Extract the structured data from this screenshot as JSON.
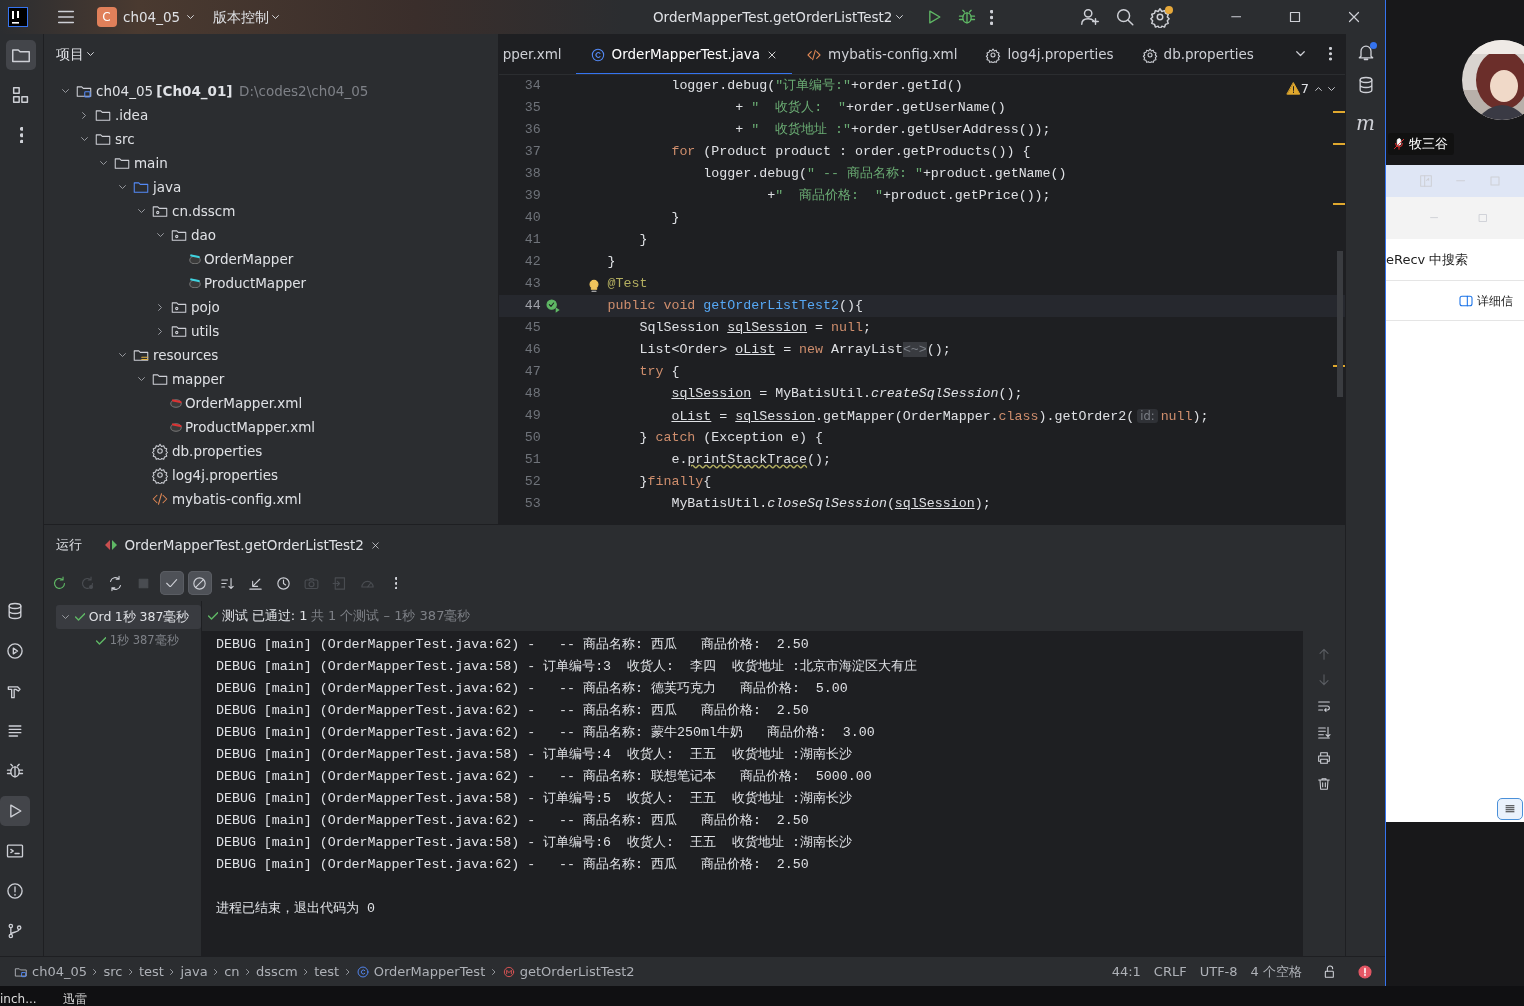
{
  "title_bar": {
    "project_initial": "C",
    "project": "ch04_05",
    "vcs": "版本控制",
    "run_config": "OrderMapperTest.getOrderListTest2"
  },
  "left_strip": {
    "top": [
      {
        "selected": true
      },
      {
        "selected": false
      },
      {
        "selected": false
      }
    ],
    "bottom": [
      {
        "selected": false
      },
      {
        "selected": false
      },
      {
        "selected": false
      },
      {
        "selected": false
      },
      {
        "selected": false
      },
      {
        "selected": true
      },
      {
        "selected": false
      },
      {
        "selected": false
      },
      {
        "selected": false
      }
    ]
  },
  "right_strip": {
    "maven_label": "m"
  },
  "project_panel": {
    "title": "项目",
    "tree": [
      {
        "name": "ch04_05",
        "module": "[Ch04_01]",
        "path": "D:\\codes2\\ch04_05",
        "kind": "module",
        "expanded": true,
        "children": [
          {
            "name": ".idea",
            "kind": "folder",
            "expanded": false
          },
          {
            "name": "src",
            "kind": "folder",
            "expanded": true,
            "children": [
              {
                "name": "main",
                "kind": "folder",
                "expanded": true,
                "children": [
                  {
                    "name": "java",
                    "kind": "source",
                    "expanded": true,
                    "children": [
                      {
                        "name": "cn.dsscm",
                        "kind": "package",
                        "expanded": true,
                        "children": [
                          {
                            "name": "dao",
                            "kind": "package",
                            "expanded": true,
                            "children": [
                              {
                                "name": "OrderMapper",
                                "kind": "mapper"
                              },
                              {
                                "name": "ProductMapper",
                                "kind": "mapper"
                              }
                            ]
                          },
                          {
                            "name": "pojo",
                            "kind": "package",
                            "expanded": false
                          },
                          {
                            "name": "utils",
                            "kind": "package",
                            "expanded": false
                          }
                        ]
                      }
                    ]
                  },
                  {
                    "name": "resources",
                    "kind": "resources",
                    "expanded": true,
                    "children": [
                      {
                        "name": "mapper",
                        "kind": "folder",
                        "expanded": true,
                        "children": [
                          {
                            "name": "OrderMapper.xml",
                            "kind": "mapping"
                          },
                          {
                            "name": "ProductMapper.xml",
                            "kind": "mapping"
                          }
                        ]
                      },
                      {
                        "name": "db.properties",
                        "kind": "properties"
                      },
                      {
                        "name": "log4j.properties",
                        "kind": "properties"
                      },
                      {
                        "name": "mybatis-config.xml",
                        "kind": "xml"
                      }
                    ]
                  }
                ]
              }
            ]
          }
        ]
      }
    ]
  },
  "editor": {
    "tabs": [
      {
        "label": "pper.xml",
        "kind": "plain",
        "selected": false
      },
      {
        "label": "OrderMapperTest.java",
        "kind": "class",
        "selected": true
      },
      {
        "label": "mybatis-config.xml",
        "kind": "xml",
        "selected": false
      },
      {
        "label": "log4j.properties",
        "kind": "properties",
        "selected": false
      },
      {
        "label": "db.properties",
        "kind": "properties",
        "selected": false
      }
    ],
    "warnings": "7",
    "lines": [
      {
        "number": "34",
        "kind": "plain",
        "current": false,
        "segments": [
          {
            "text": "            logger.debug(",
            "kind": "plain"
          },
          {
            "text": "\"订单编号:\"",
            "kind": "string"
          },
          {
            "text": "+order.getId()",
            "kind": "plain"
          }
        ]
      },
      {
        "number": "35",
        "kind": "plain",
        "current": false,
        "segments": [
          {
            "text": "                    + ",
            "kind": "plain"
          },
          {
            "text": "\"  收货人:  \"",
            "kind": "string"
          },
          {
            "text": "+order.getUserName()",
            "kind": "plain"
          }
        ]
      },
      {
        "number": "36",
        "kind": "plain",
        "current": false,
        "segments": [
          {
            "text": "                    + ",
            "kind": "plain"
          },
          {
            "text": "\"  收货地址 :\"",
            "kind": "string"
          },
          {
            "text": "+order.getUserAddress());",
            "kind": "plain"
          }
        ]
      },
      {
        "number": "37",
        "kind": "plain",
        "current": false,
        "segments": [
          {
            "text": "            for",
            "kind": "keyword"
          },
          {
            "text": " (Product product : order.getProducts()) {",
            "kind": "plain"
          }
        ]
      },
      {
        "number": "38",
        "kind": "plain",
        "current": false,
        "segments": [
          {
            "text": "                logger.debug(",
            "kind": "plain"
          },
          {
            "text": "\" -- 商品名称: \"",
            "kind": "string"
          },
          {
            "text": "+product.getName()",
            "kind": "plain"
          }
        ]
      },
      {
        "number": "39",
        "kind": "plain",
        "current": false,
        "segments": [
          {
            "text": "                        +",
            "kind": "plain"
          },
          {
            "text": "\"  商品价格:  \"",
            "kind": "string"
          },
          {
            "text": "+product.getPrice());",
            "kind": "plain"
          }
        ]
      },
      {
        "number": "40",
        "kind": "plain",
        "current": false,
        "segments": [
          {
            "text": "            }",
            "kind": "plain"
          }
        ]
      },
      {
        "number": "41",
        "kind": "plain",
        "current": false,
        "segments": [
          {
            "text": "        }",
            "kind": "plain"
          }
        ]
      },
      {
        "number": "42",
        "kind": "plain",
        "current": false,
        "segments": [
          {
            "text": "    }",
            "kind": "plain"
          }
        ]
      },
      {
        "number": "43",
        "kind": "bulb",
        "current": false,
        "segments": [
          {
            "text": "    @Test",
            "kind": "annotation"
          }
        ]
      },
      {
        "number": "44",
        "kind": "run",
        "current": true,
        "segments": [
          {
            "text": "    public void ",
            "kind": "keyword"
          },
          {
            "text": "getOrderListTest2",
            "kind": "method"
          },
          {
            "text": "(){",
            "kind": "plain"
          }
        ]
      },
      {
        "number": "45",
        "kind": "plain",
        "current": false,
        "segments": [
          {
            "text": "        SqlSession ",
            "kind": "plain"
          },
          {
            "text": "sqlSession",
            "kind": "variable"
          },
          {
            "text": " = ",
            "kind": "plain"
          },
          {
            "text": "null",
            "kind": "keyword"
          },
          {
            "text": ";",
            "kind": "plain"
          }
        ]
      },
      {
        "number": "46",
        "kind": "plain",
        "current": false,
        "segments": [
          {
            "text": "        List<Order> ",
            "kind": "plain"
          },
          {
            "text": "oList",
            "kind": "variable"
          },
          {
            "text": " = ",
            "kind": "plain"
          },
          {
            "text": "new",
            "kind": "keyword"
          },
          {
            "text": " ArrayList",
            "kind": "plain"
          },
          {
            "text": "<~>",
            "kind": "fold"
          },
          {
            "text": "();",
            "kind": "plain"
          }
        ]
      },
      {
        "number": "47",
        "kind": "plain",
        "current": false,
        "segments": [
          {
            "text": "        try",
            "kind": "keyword"
          },
          {
            "text": " {",
            "kind": "plain"
          }
        ]
      },
      {
        "number": "48",
        "kind": "plain",
        "current": false,
        "segments": [
          {
            "text": "            sqlSession",
            "kind": "variable"
          },
          {
            "text": " = MyBatisUtil.",
            "kind": "plain"
          },
          {
            "text": "createSqlSession",
            "kind": "static"
          },
          {
            "text": "();",
            "kind": "plain"
          }
        ]
      },
      {
        "number": "49",
        "kind": "plain",
        "current": false,
        "segments": [
          {
            "text": "            oList",
            "kind": "variable"
          },
          {
            "text": " = ",
            "kind": "plain"
          },
          {
            "text": "sqlSession",
            "kind": "variable"
          },
          {
            "text": ".getMapper(OrderMapper.",
            "kind": "plain"
          },
          {
            "text": "class",
            "kind": "keyword"
          },
          {
            "text": ").getOrder2(",
            "kind": "plain"
          },
          {
            "text": "id:",
            "kind": "hint"
          },
          {
            "text": "null",
            "kind": "keyword"
          },
          {
            "text": ");",
            "kind": "plain"
          }
        ]
      },
      {
        "number": "50",
        "kind": "plain",
        "current": false,
        "segments": [
          {
            "text": "        } ",
            "kind": "plain"
          },
          {
            "text": "catch",
            "kind": "keyword"
          },
          {
            "text": " (Exception e) {",
            "kind": "plain"
          }
        ]
      },
      {
        "number": "51",
        "kind": "plain",
        "current": false,
        "segments": [
          {
            "text": "            e.",
            "kind": "plain"
          },
          {
            "text": "printStackTrace",
            "kind": "warning"
          },
          {
            "text": "();",
            "kind": "plain"
          }
        ]
      },
      {
        "number": "52",
        "kind": "plain",
        "current": false,
        "segments": [
          {
            "text": "        }",
            "kind": "plain"
          },
          {
            "text": "finally",
            "kind": "keyword"
          },
          {
            "text": "{",
            "kind": "plain"
          }
        ]
      },
      {
        "number": "53",
        "kind": "plain",
        "current": false,
        "segments": [
          {
            "text": "            MyBatisUtil.",
            "kind": "plain"
          },
          {
            "text": "closeSqlSession",
            "kind": "static"
          },
          {
            "text": "(",
            "kind": "plain"
          },
          {
            "text": "sqlSession",
            "kind": "variable"
          },
          {
            "text": ");",
            "kind": "plain"
          }
        ]
      }
    ]
  },
  "run_panel": {
    "title": "运行",
    "tab": "OrderMapperTest.getOrderListTest2",
    "toolbar": [
      {
        "on": false,
        "disabled": false
      },
      {
        "on": false,
        "disabled": true
      },
      {
        "on": false,
        "disabled": false
      },
      {
        "on": false,
        "disabled": true
      },
      {
        "on": true,
        "disabled": false
      },
      {
        "on": true,
        "disabled": false
      },
      {
        "on": false,
        "disabled": false
      },
      {
        "on": false,
        "disabled": false
      },
      {
        "on": false,
        "disabled": false
      },
      {
        "on": false,
        "disabled": true
      },
      {
        "on": false,
        "disabled": true
      },
      {
        "on": false,
        "disabled": true
      },
      {
        "on": false,
        "disabled": false
      }
    ],
    "tests": [
      {
        "name": "Ord",
        "time": "1秒 387毫秒",
        "passed": true,
        "expanded": true,
        "children": [
          {
            "time": "1秒 387毫秒",
            "passed": true
          }
        ]
      }
    ],
    "summary": {
      "status": "测试 已通过: 1",
      "detail": "共 1 个测试 – 1秒 387毫秒"
    },
    "console": [
      "DEBUG [main] (OrderMapperTest.java:62) -   -- 商品名称: 西瓜   商品价格:  2.50",
      "DEBUG [main] (OrderMapperTest.java:58) - 订单编号:3  收货人:  李四  收货地址 :北京市海淀区大有庄",
      "DEBUG [main] (OrderMapperTest.java:62) -   -- 商品名称: 德芙巧克力   商品价格:  5.00",
      "DEBUG [main] (OrderMapperTest.java:62) -   -- 商品名称: 西瓜   商品价格:  2.50",
      "DEBUG [main] (OrderMapperTest.java:62) -   -- 商品名称: 蒙牛250ml牛奶   商品价格:  3.00",
      "DEBUG [main] (OrderMapperTest.java:58) - 订单编号:4  收货人:  王五  收货地址 :湖南长沙",
      "DEBUG [main] (OrderMapperTest.java:62) -   -- 商品名称: 联想笔记本   商品价格:  5000.00",
      "DEBUG [main] (OrderMapperTest.java:58) - 订单编号:5  收货人:  王五  收货地址 :湖南长沙",
      "DEBUG [main] (OrderMapperTest.java:62) -   -- 商品名称: 西瓜   商品价格:  2.50",
      "DEBUG [main] (OrderMapperTest.java:58) - 订单编号:6  收货人:  王五  收货地址 :湖南长沙",
      "DEBUG [main] (OrderMapperTest.java:62) -   -- 商品名称: 西瓜   商品价格:  2.50"
    ],
    "exit_message": "进程已结束，退出代码为 0",
    "side_tools": [
      {
        "disabled": true
      },
      {
        "disabled": true
      },
      {
        "disabled": false
      },
      {
        "disabled": false
      },
      {
        "disabled": false
      },
      {
        "disabled": false
      }
    ]
  },
  "status_bar": {
    "breadcrumbs": [
      {
        "label": "ch04_05",
        "kind": "module"
      },
      {
        "label": "src",
        "kind": "plain"
      },
      {
        "label": "test",
        "kind": "plain"
      },
      {
        "label": "java",
        "kind": "plain"
      },
      {
        "label": "cn",
        "kind": "plain"
      },
      {
        "label": "dsscm",
        "kind": "plain"
      },
      {
        "label": "test",
        "kind": "plain"
      },
      {
        "label": "OrderMapperTest",
        "kind": "class"
      },
      {
        "label": "getOrderListTest2",
        "kind": "method"
      }
    ],
    "position": "44:1",
    "line_ending": "CRLF",
    "encoding": "UTF-8",
    "indent": "4 个空格"
  },
  "desktop": {
    "user": "牧三谷",
    "window": {
      "search": "eRecv 中搜索",
      "details": "详细信"
    },
    "taskbar": [
      "inch...",
      "迅雷"
    ]
  }
}
